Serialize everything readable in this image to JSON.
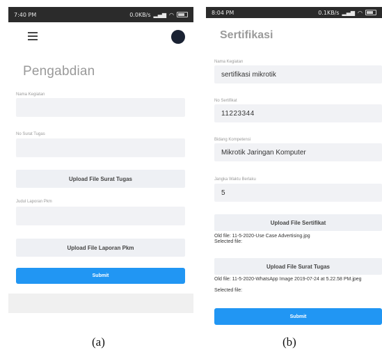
{
  "panel_a": {
    "status_time": "7:40 PM",
    "status_right": "0.0KB/s",
    "title": "Pengabdian",
    "label_nama": "Nama Kegiatan",
    "label_no_surat": "No Surat Tugas",
    "upload_surat": "Upload File Surat Tugas",
    "label_judul": "Judul Laporan Pkm",
    "upload_laporan": "Upload File Laporan Pkm",
    "submit": "Submit",
    "caption": "(a)"
  },
  "panel_b": {
    "status_time": "8:04 PM",
    "status_right": "0.1KB/s",
    "title": "Sertifikasi",
    "label_nama": "Nama Kegiatan",
    "value_nama": "sertifikasi mikrotik",
    "label_no_sertifikat": "No Sertifikat",
    "value_no_sertifikat": "11223344",
    "label_bidang": "Bidang Kompetensi",
    "value_bidang": "Mikrotik Jaringan Komputer",
    "label_jangka": "Jangka Waktu Berlaku",
    "value_jangka": "5",
    "upload_sertifikat": "Upload File Sertifikat",
    "old_file_1": "Old file: 11-5-2020-Use Case Advertising.jpg",
    "selected_file_1": "Selected file:",
    "upload_surat": "Upload File Surat Tugas",
    "old_file_2": "Old file: 11-5-2020-WhatsApp Image 2019-07-24 at 5.22.58 PM.jpeg",
    "selected_file_2": "Selected file:",
    "submit": "Submit",
    "caption": "(b)"
  }
}
